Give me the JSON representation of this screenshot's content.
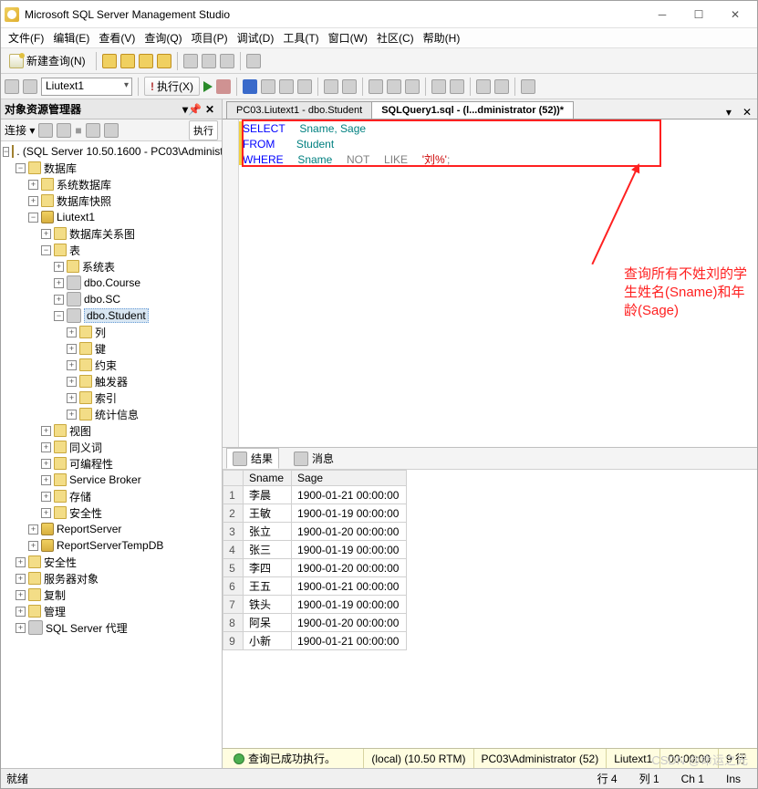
{
  "window": {
    "title": "Microsoft SQL Server Management Studio"
  },
  "menu": {
    "file": "文件(F)",
    "edit": "编辑(E)",
    "view": "查看(V)",
    "query": "查询(Q)",
    "project": "项目(P)",
    "debug": "调试(D)",
    "tools": "工具(T)",
    "window": "窗口(W)",
    "community": "社区(C)",
    "help": "帮助(H)"
  },
  "toolbar1": {
    "new_query": "新建查询(N)"
  },
  "toolbar2": {
    "combo": "Liutext1",
    "execute": "执行(X)"
  },
  "object_explorer": {
    "title": "对象资源管理器",
    "connect": "连接 ▾",
    "exec_btn": "执行",
    "root": ". (SQL Server 10.50.1600 - PC03\\Administr",
    "nodes": {
      "databases": "数据库",
      "sysdb": "系统数据库",
      "snapshot": "数据库快照",
      "liutext1": "Liutext1",
      "dbdiagram": "数据库关系图",
      "tables": "表",
      "systables": "系统表",
      "course": "dbo.Course",
      "sc": "dbo.SC",
      "student": "dbo.Student",
      "columns": "列",
      "keys": "键",
      "constraints": "约束",
      "triggers": "触发器",
      "indexes": "索引",
      "stats": "统计信息",
      "views": "视图",
      "synonyms": "同义词",
      "programmability": "可编程性",
      "servicebroker": "Service Broker",
      "storage": "存储",
      "security_db": "安全性",
      "reportserver": "ReportServer",
      "reportservertemp": "ReportServerTempDB",
      "security": "安全性",
      "serverobjects": "服务器对象",
      "replication": "复制",
      "management": "管理",
      "sqlagent": "SQL Server 代理"
    }
  },
  "tabs": {
    "inactive": "PC03.Liutext1 - dbo.Student",
    "active": "SQLQuery1.sql - (l...dministrator (52))*"
  },
  "sql": {
    "select": "SELECT",
    "from": "FROM",
    "where": "WHERE",
    "not": "NOT",
    "like": "LIKE",
    "cols": "Sname, Sage",
    "tbl": "Student",
    "col": "Sname",
    "lit": "'刘%'",
    "semi": ";"
  },
  "annotation": "查询所有不姓刘的学生姓名(Sname)和年龄(Sage)",
  "results": {
    "tab_results": "结果",
    "tab_messages": "消息",
    "headers": {
      "rownum": "",
      "c1": "Sname",
      "c2": "Sage"
    },
    "rows": [
      {
        "n": "1",
        "sname": "李晨",
        "sage": "1900-01-21 00:00:00"
      },
      {
        "n": "2",
        "sname": "王敏",
        "sage": "1900-01-19 00:00:00"
      },
      {
        "n": "3",
        "sname": "张立",
        "sage": "1900-01-20 00:00:00"
      },
      {
        "n": "4",
        "sname": "张三",
        "sage": "1900-01-19 00:00:00"
      },
      {
        "n": "5",
        "sname": "李四",
        "sage": "1900-01-20 00:00:00"
      },
      {
        "n": "6",
        "sname": "王五",
        "sage": "1900-01-21 00:00:00"
      },
      {
        "n": "7",
        "sname": "铁头",
        "sage": "1900-01-19 00:00:00"
      },
      {
        "n": "8",
        "sname": "阿呆",
        "sage": "1900-01-20 00:00:00"
      },
      {
        "n": "9",
        "sname": "小新",
        "sage": "1900-01-21 00:00:00"
      }
    ]
  },
  "status": {
    "ok": "查询已成功执行。",
    "server": "(local) (10.50 RTM)",
    "user": "PC03\\Administrator (52)",
    "db": "Liutext1",
    "time": "00:00:00",
    "rows": "9 行"
  },
  "bottom": {
    "ready": "就绪",
    "row": "行 4",
    "col": "列 1",
    "ch": "Ch 1",
    "ins": "Ins"
  },
  "watermark": "CSDN @命运之光"
}
